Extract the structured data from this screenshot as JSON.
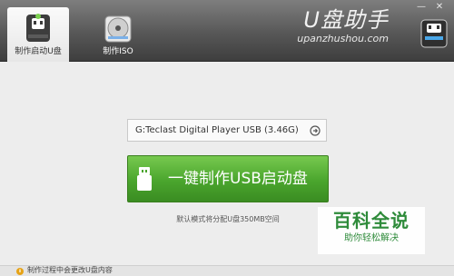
{
  "tabs": [
    {
      "label": "制作启动U盘",
      "icon": "usb-drive-icon",
      "active": true
    },
    {
      "label": "制作ISO",
      "icon": "disc-icon",
      "active": false
    }
  ],
  "brand": {
    "title": "U盘助手",
    "url": "upanzhushou.com"
  },
  "window_controls": {
    "minimize": "—",
    "close": "✕"
  },
  "device_select": {
    "value": "G:Teclast Digital Player USB (3.46G)",
    "icon": "arrow-circle-icon"
  },
  "make_button": {
    "label": "一键制作USB启动盘",
    "icon": "usb-icon",
    "color": "#4aa52d"
  },
  "hint": "默认模式将分配U盘350MB空间",
  "watermark": {
    "title": "百科全说",
    "subtitle": "助你轻松解决"
  },
  "footer": {
    "text": "制作过程中会更改U盘内容"
  }
}
